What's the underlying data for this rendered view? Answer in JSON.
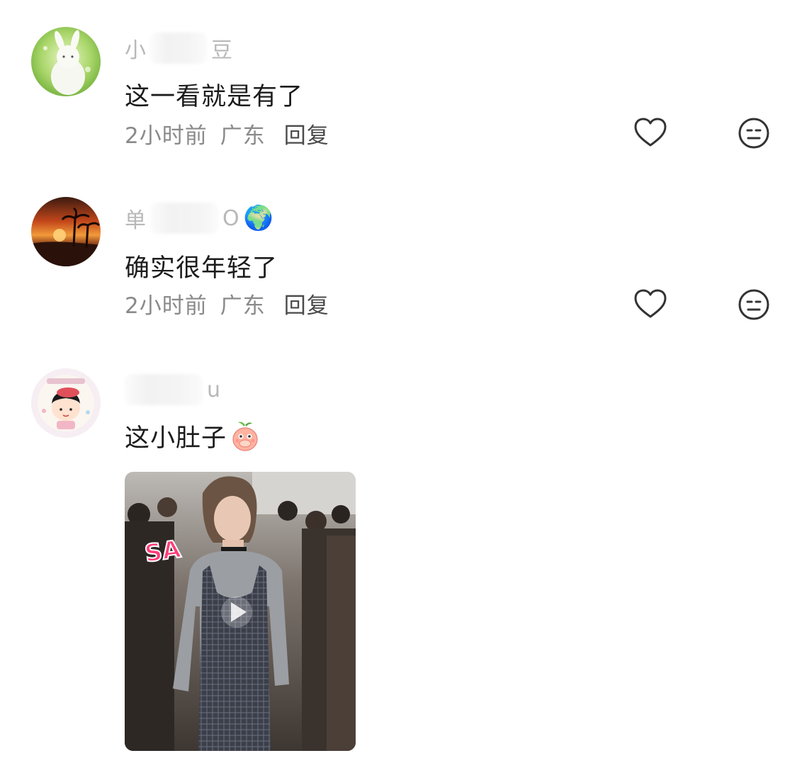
{
  "comments": [
    {
      "username_visible_start": "小",
      "username_visible_end": "豆",
      "text": "这一看就是有了",
      "time": "2小时前",
      "location": "广东",
      "reply_label": "回复"
    },
    {
      "username_visible_start": "单",
      "username_visible_end": "O",
      "username_emoji": "🌍",
      "text": "确实很年轻了",
      "time": "2小时前",
      "location": "广东",
      "reply_label": "回复"
    },
    {
      "username_visible_end": "u",
      "text": "这小肚子",
      "emoji_sticker": "peach-covering-mouth",
      "media": {
        "type": "video",
        "overlay_text": "SA"
      }
    }
  ],
  "icons": {
    "like": "heart-outline-icon",
    "dislike": "meh-face-icon",
    "play": "play-icon"
  },
  "colors": {
    "primary_text": "#1c1c1c",
    "meta_text": "#8a8a8a",
    "username_text": "#b8b8b8",
    "icon_stroke": "#333333"
  }
}
